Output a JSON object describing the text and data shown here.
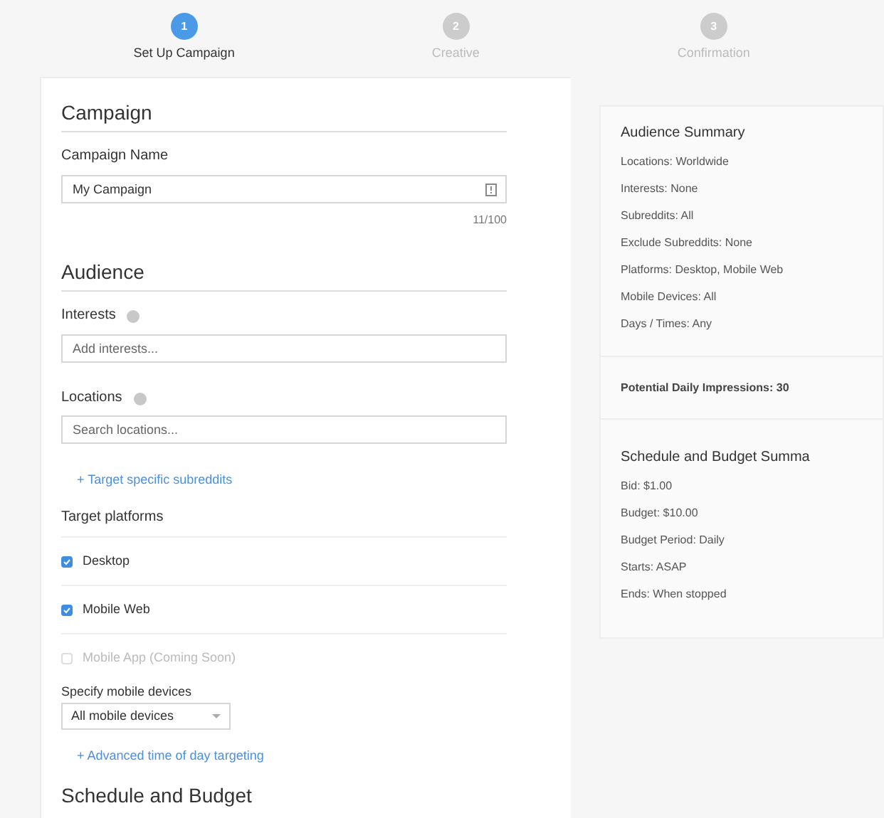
{
  "steps": [
    {
      "number": "1",
      "label": "Set Up Campaign",
      "selected": true
    },
    {
      "number": "2",
      "label": "Creative",
      "selected": false
    },
    {
      "number": "3",
      "label": "Confirmation",
      "selected": false
    }
  ],
  "campaign": {
    "heading": "Campaign",
    "name_label": "Campaign Name",
    "name_value": "My Campaign",
    "counter": "11/100"
  },
  "audience": {
    "heading": "Audience",
    "interests_label": "Interests",
    "interests_placeholder": "Add interests...",
    "locations_label": "Locations",
    "locations_placeholder": "Search locations...",
    "subreddits_link": "+ Target specific subreddits",
    "platforms_label": "Target platforms",
    "platforms": [
      {
        "label": "Desktop",
        "checked": true,
        "disabled": false
      },
      {
        "label": "Mobile Web",
        "checked": true,
        "disabled": false
      },
      {
        "label": "Mobile App (Coming Soon)",
        "checked": false,
        "disabled": true
      }
    ],
    "devices_label": "Specify mobile devices",
    "devices_value": "All mobile devices",
    "time_link": "+ Advanced time of day targeting"
  },
  "schedule": {
    "heading": "Schedule and Budget"
  },
  "summary": {
    "audience_title": "Audience Summary",
    "audience_lines": [
      "Locations: Worldwide",
      "Interests: None",
      "Subreddits: All",
      "Exclude Subreddits: None",
      "Platforms: Desktop, Mobile Web",
      "Mobile Devices: All",
      "Days / Times: Any"
    ],
    "impressions": "Potential Daily Impressions: 30",
    "schedule_title": "Schedule and Budget Summa",
    "schedule_lines": [
      "Bid: $1.00",
      "Budget: $10.00",
      "Budget Period: Daily",
      "Starts: ASAP",
      "Ends: When stopped"
    ]
  }
}
